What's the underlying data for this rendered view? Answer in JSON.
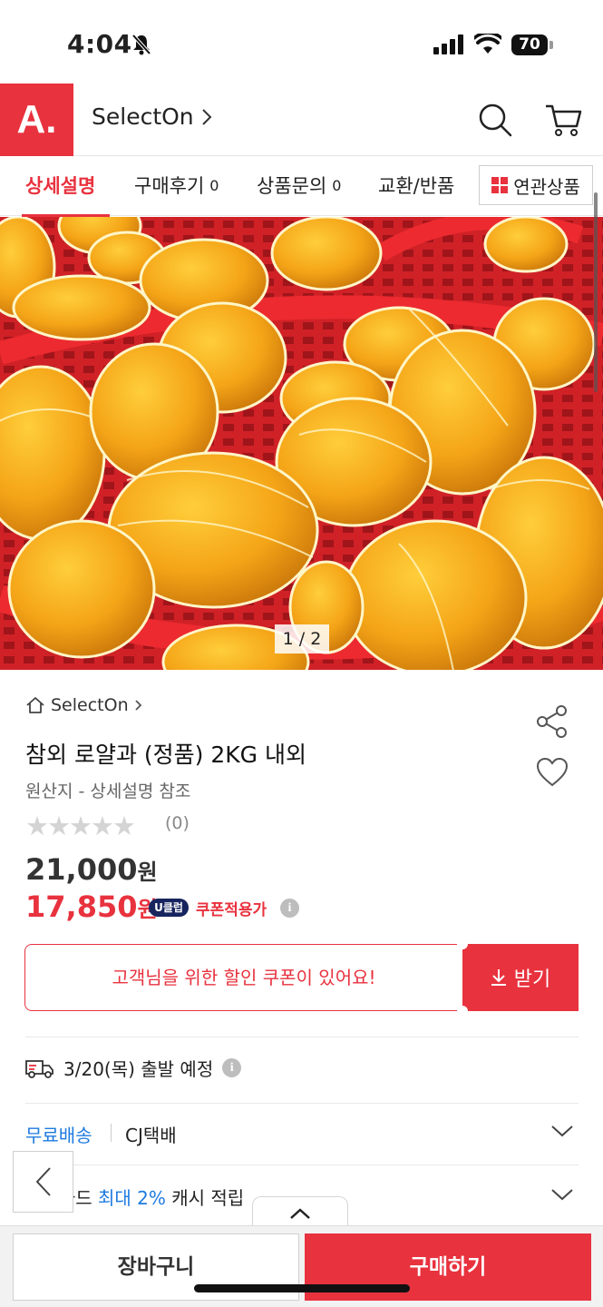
{
  "status_bar": {
    "time": "4:04",
    "battery": "70"
  },
  "header": {
    "logo": "A.",
    "store_name": "SelectOn",
    "chevron": "›"
  },
  "tabs": [
    {
      "label": "상세설명",
      "count": ""
    },
    {
      "label": "구매후기",
      "count": "0"
    },
    {
      "label": "상품문의",
      "count": "0"
    },
    {
      "label": "교환/반품",
      "count": ""
    }
  ],
  "related_button": "연관상품",
  "image": {
    "counter": "1 / 2"
  },
  "product": {
    "store": "SelectOn",
    "title": "참외 로얄과 (정품) 2KG 내외",
    "origin": "원산지 - 상세설명 참조",
    "stars": "★★★★★",
    "review_count": "(0)",
    "rating": 0
  },
  "price": {
    "original": "21,000",
    "original_unit": "원",
    "sale": "17,850",
    "sale_unit": "원",
    "badge": "U클럽",
    "coupon_label": "쿠폰적용가",
    "info": "i"
  },
  "coupon": {
    "message": "고객님을 위한 할인 쿠폰이 있어요!",
    "button": "받기"
  },
  "shipping": {
    "departure": "3/20(목) 출발 예정",
    "free": "무료배송",
    "courier": "CJ택배",
    "card_prefix": "삼성카드 ",
    "card_highlight": "최대 2%",
    "card_suffix": " 캐시 적립"
  },
  "bottom": {
    "cart": "장바구니",
    "buy": "구매하기"
  },
  "colors": {
    "accent": "#e8323e",
    "link": "#1e7be0",
    "badge": "#17245e"
  }
}
